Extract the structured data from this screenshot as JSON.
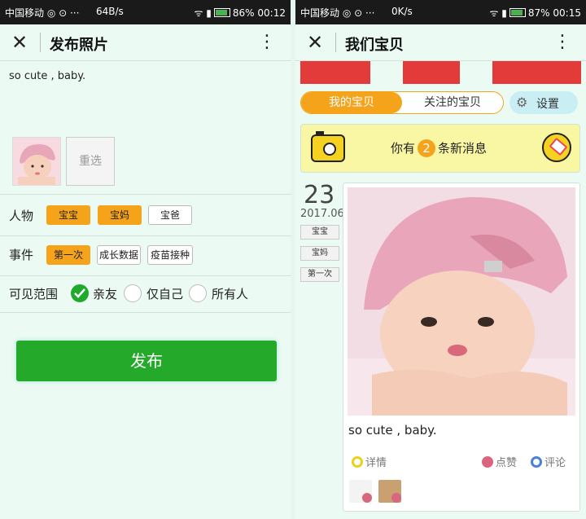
{
  "left": {
    "status": {
      "carrier": "中国移动",
      "speed": "64B/s",
      "battery": "86%",
      "battery_level": 0.86,
      "time": "00:12"
    },
    "appbar": {
      "title": "发布照片"
    },
    "caption": "so cute , baby.",
    "reselect_label": "重选",
    "person": {
      "label": "人物",
      "tags": [
        {
          "text": "宝宝",
          "selected": true
        },
        {
          "text": "宝妈",
          "selected": true
        },
        {
          "text": "宝爸",
          "selected": false
        }
      ]
    },
    "event": {
      "label": "事件",
      "tags": [
        {
          "text": "第一次",
          "selected": true
        },
        {
          "text": "成长数据",
          "selected": false
        },
        {
          "text": "疫苗接种",
          "selected": false
        }
      ]
    },
    "visibility": {
      "label": "可见范围",
      "options": [
        {
          "text": "亲友",
          "selected": true
        },
        {
          "text": "仅自己",
          "selected": false
        },
        {
          "text": "所有人",
          "selected": false
        }
      ]
    },
    "publish_label": "发布"
  },
  "right": {
    "status": {
      "carrier": "中国移动",
      "speed": "0K/s",
      "battery": "87%",
      "battery_level": 0.87,
      "time": "00:15"
    },
    "appbar": {
      "title": "我们宝贝"
    },
    "tabs": [
      "我的宝贝",
      "关注的宝贝"
    ],
    "settings_label": "设置",
    "message": {
      "prefix": "你有",
      "count": "2",
      "suffix": "条新消息"
    },
    "date": {
      "day": "23",
      "year_month": "2017.06"
    },
    "post_tags": [
      "宝宝",
      "宝妈",
      "第一次"
    ],
    "post_caption": "so cute , baby.",
    "actions": {
      "detail": "详情",
      "like": "点赞",
      "comment": "评论"
    }
  },
  "colors": {
    "accent_orange": "#f5a31a",
    "publish_green": "#25a92a",
    "background": "#ecfaf4"
  }
}
